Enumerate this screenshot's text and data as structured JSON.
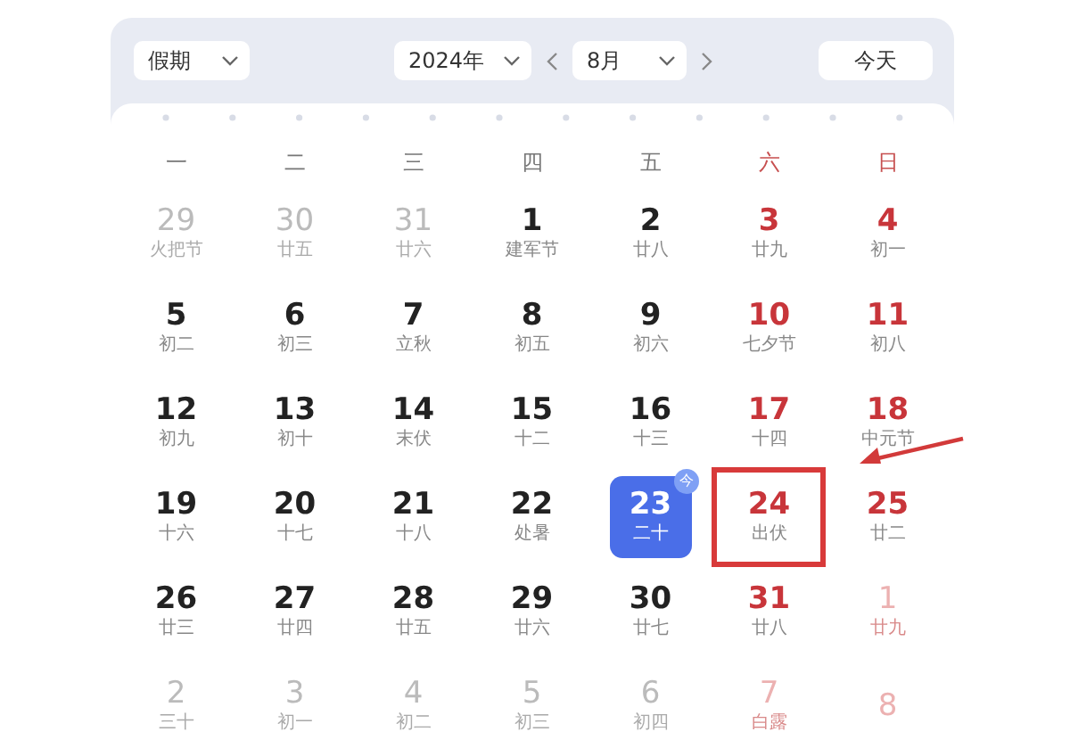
{
  "toolbar": {
    "holiday_select": "假期",
    "year_select": "2024年",
    "month_select": "8月",
    "today_button": "今天"
  },
  "weekdays": [
    {
      "label": "一",
      "weekend": false
    },
    {
      "label": "二",
      "weekend": false
    },
    {
      "label": "三",
      "weekend": false
    },
    {
      "label": "四",
      "weekend": false
    },
    {
      "label": "五",
      "weekend": false
    },
    {
      "label": "六",
      "weekend": true
    },
    {
      "label": "日",
      "weekend": true
    }
  ],
  "weeks": [
    [
      {
        "day": "29",
        "lunar": "火把节",
        "in_month": false,
        "weekend": false,
        "selected": false,
        "marked": false
      },
      {
        "day": "30",
        "lunar": "廿五",
        "in_month": false,
        "weekend": false,
        "selected": false,
        "marked": false
      },
      {
        "day": "31",
        "lunar": "廿六",
        "in_month": false,
        "weekend": false,
        "selected": false,
        "marked": false
      },
      {
        "day": "1",
        "lunar": "建军节",
        "in_month": true,
        "weekend": false,
        "selected": false,
        "marked": false
      },
      {
        "day": "2",
        "lunar": "廿八",
        "in_month": true,
        "weekend": false,
        "selected": false,
        "marked": false
      },
      {
        "day": "3",
        "lunar": "廿九",
        "in_month": true,
        "weekend": true,
        "selected": false,
        "marked": false
      },
      {
        "day": "4",
        "lunar": "初一",
        "in_month": true,
        "weekend": true,
        "selected": false,
        "marked": false
      }
    ],
    [
      {
        "day": "5",
        "lunar": "初二",
        "in_month": true,
        "weekend": false,
        "selected": false,
        "marked": false
      },
      {
        "day": "6",
        "lunar": "初三",
        "in_month": true,
        "weekend": false,
        "selected": false,
        "marked": false
      },
      {
        "day": "7",
        "lunar": "立秋",
        "in_month": true,
        "weekend": false,
        "selected": false,
        "marked": false
      },
      {
        "day": "8",
        "lunar": "初五",
        "in_month": true,
        "weekend": false,
        "selected": false,
        "marked": false
      },
      {
        "day": "9",
        "lunar": "初六",
        "in_month": true,
        "weekend": false,
        "selected": false,
        "marked": false
      },
      {
        "day": "10",
        "lunar": "七夕节",
        "in_month": true,
        "weekend": true,
        "selected": false,
        "marked": false
      },
      {
        "day": "11",
        "lunar": "初八",
        "in_month": true,
        "weekend": true,
        "selected": false,
        "marked": false
      }
    ],
    [
      {
        "day": "12",
        "lunar": "初九",
        "in_month": true,
        "weekend": false,
        "selected": false,
        "marked": false
      },
      {
        "day": "13",
        "lunar": "初十",
        "in_month": true,
        "weekend": false,
        "selected": false,
        "marked": false
      },
      {
        "day": "14",
        "lunar": "末伏",
        "in_month": true,
        "weekend": false,
        "selected": false,
        "marked": false
      },
      {
        "day": "15",
        "lunar": "十二",
        "in_month": true,
        "weekend": false,
        "selected": false,
        "marked": false
      },
      {
        "day": "16",
        "lunar": "十三",
        "in_month": true,
        "weekend": false,
        "selected": false,
        "marked": false
      },
      {
        "day": "17",
        "lunar": "十四",
        "in_month": true,
        "weekend": true,
        "selected": false,
        "marked": false
      },
      {
        "day": "18",
        "lunar": "中元节",
        "in_month": true,
        "weekend": true,
        "selected": false,
        "marked": false
      }
    ],
    [
      {
        "day": "19",
        "lunar": "十六",
        "in_month": true,
        "weekend": false,
        "selected": false,
        "marked": false
      },
      {
        "day": "20",
        "lunar": "十七",
        "in_month": true,
        "weekend": false,
        "selected": false,
        "marked": false
      },
      {
        "day": "21",
        "lunar": "十八",
        "in_month": true,
        "weekend": false,
        "selected": false,
        "marked": false
      },
      {
        "day": "22",
        "lunar": "处暑",
        "in_month": true,
        "weekend": false,
        "selected": false,
        "marked": false
      },
      {
        "day": "23",
        "lunar": "二十",
        "in_month": true,
        "weekend": false,
        "selected": true,
        "marked": false,
        "badge": "今"
      },
      {
        "day": "24",
        "lunar": "出伏",
        "in_month": true,
        "weekend": true,
        "selected": false,
        "marked": true
      },
      {
        "day": "25",
        "lunar": "廿二",
        "in_month": true,
        "weekend": true,
        "selected": false,
        "marked": false
      }
    ],
    [
      {
        "day": "26",
        "lunar": "廿三",
        "in_month": true,
        "weekend": false,
        "selected": false,
        "marked": false
      },
      {
        "day": "27",
        "lunar": "廿四",
        "in_month": true,
        "weekend": false,
        "selected": false,
        "marked": false
      },
      {
        "day": "28",
        "lunar": "廿五",
        "in_month": true,
        "weekend": false,
        "selected": false,
        "marked": false
      },
      {
        "day": "29",
        "lunar": "廿六",
        "in_month": true,
        "weekend": false,
        "selected": false,
        "marked": false
      },
      {
        "day": "30",
        "lunar": "廿七",
        "in_month": true,
        "weekend": false,
        "selected": false,
        "marked": false
      },
      {
        "day": "31",
        "lunar": "廿八",
        "in_month": true,
        "weekend": true,
        "selected": false,
        "marked": false
      },
      {
        "day": "1",
        "lunar": "廿九",
        "in_month": false,
        "weekend": true,
        "selected": false,
        "marked": false
      }
    ],
    [
      {
        "day": "2",
        "lunar": "三十",
        "in_month": false,
        "weekend": false,
        "selected": false,
        "marked": false
      },
      {
        "day": "3",
        "lunar": "初一",
        "in_month": false,
        "weekend": false,
        "selected": false,
        "marked": false
      },
      {
        "day": "4",
        "lunar": "初二",
        "in_month": false,
        "weekend": false,
        "selected": false,
        "marked": false
      },
      {
        "day": "5",
        "lunar": "初三",
        "in_month": false,
        "weekend": false,
        "selected": false,
        "marked": false
      },
      {
        "day": "6",
        "lunar": "初四",
        "in_month": false,
        "weekend": false,
        "selected": false,
        "marked": false
      },
      {
        "day": "7",
        "lunar": "白露",
        "in_month": false,
        "weekend": true,
        "selected": false,
        "marked": false
      },
      {
        "day": "8",
        "in_month": false,
        "weekend": true,
        "selected": false,
        "marked": false
      }
    ]
  ]
}
